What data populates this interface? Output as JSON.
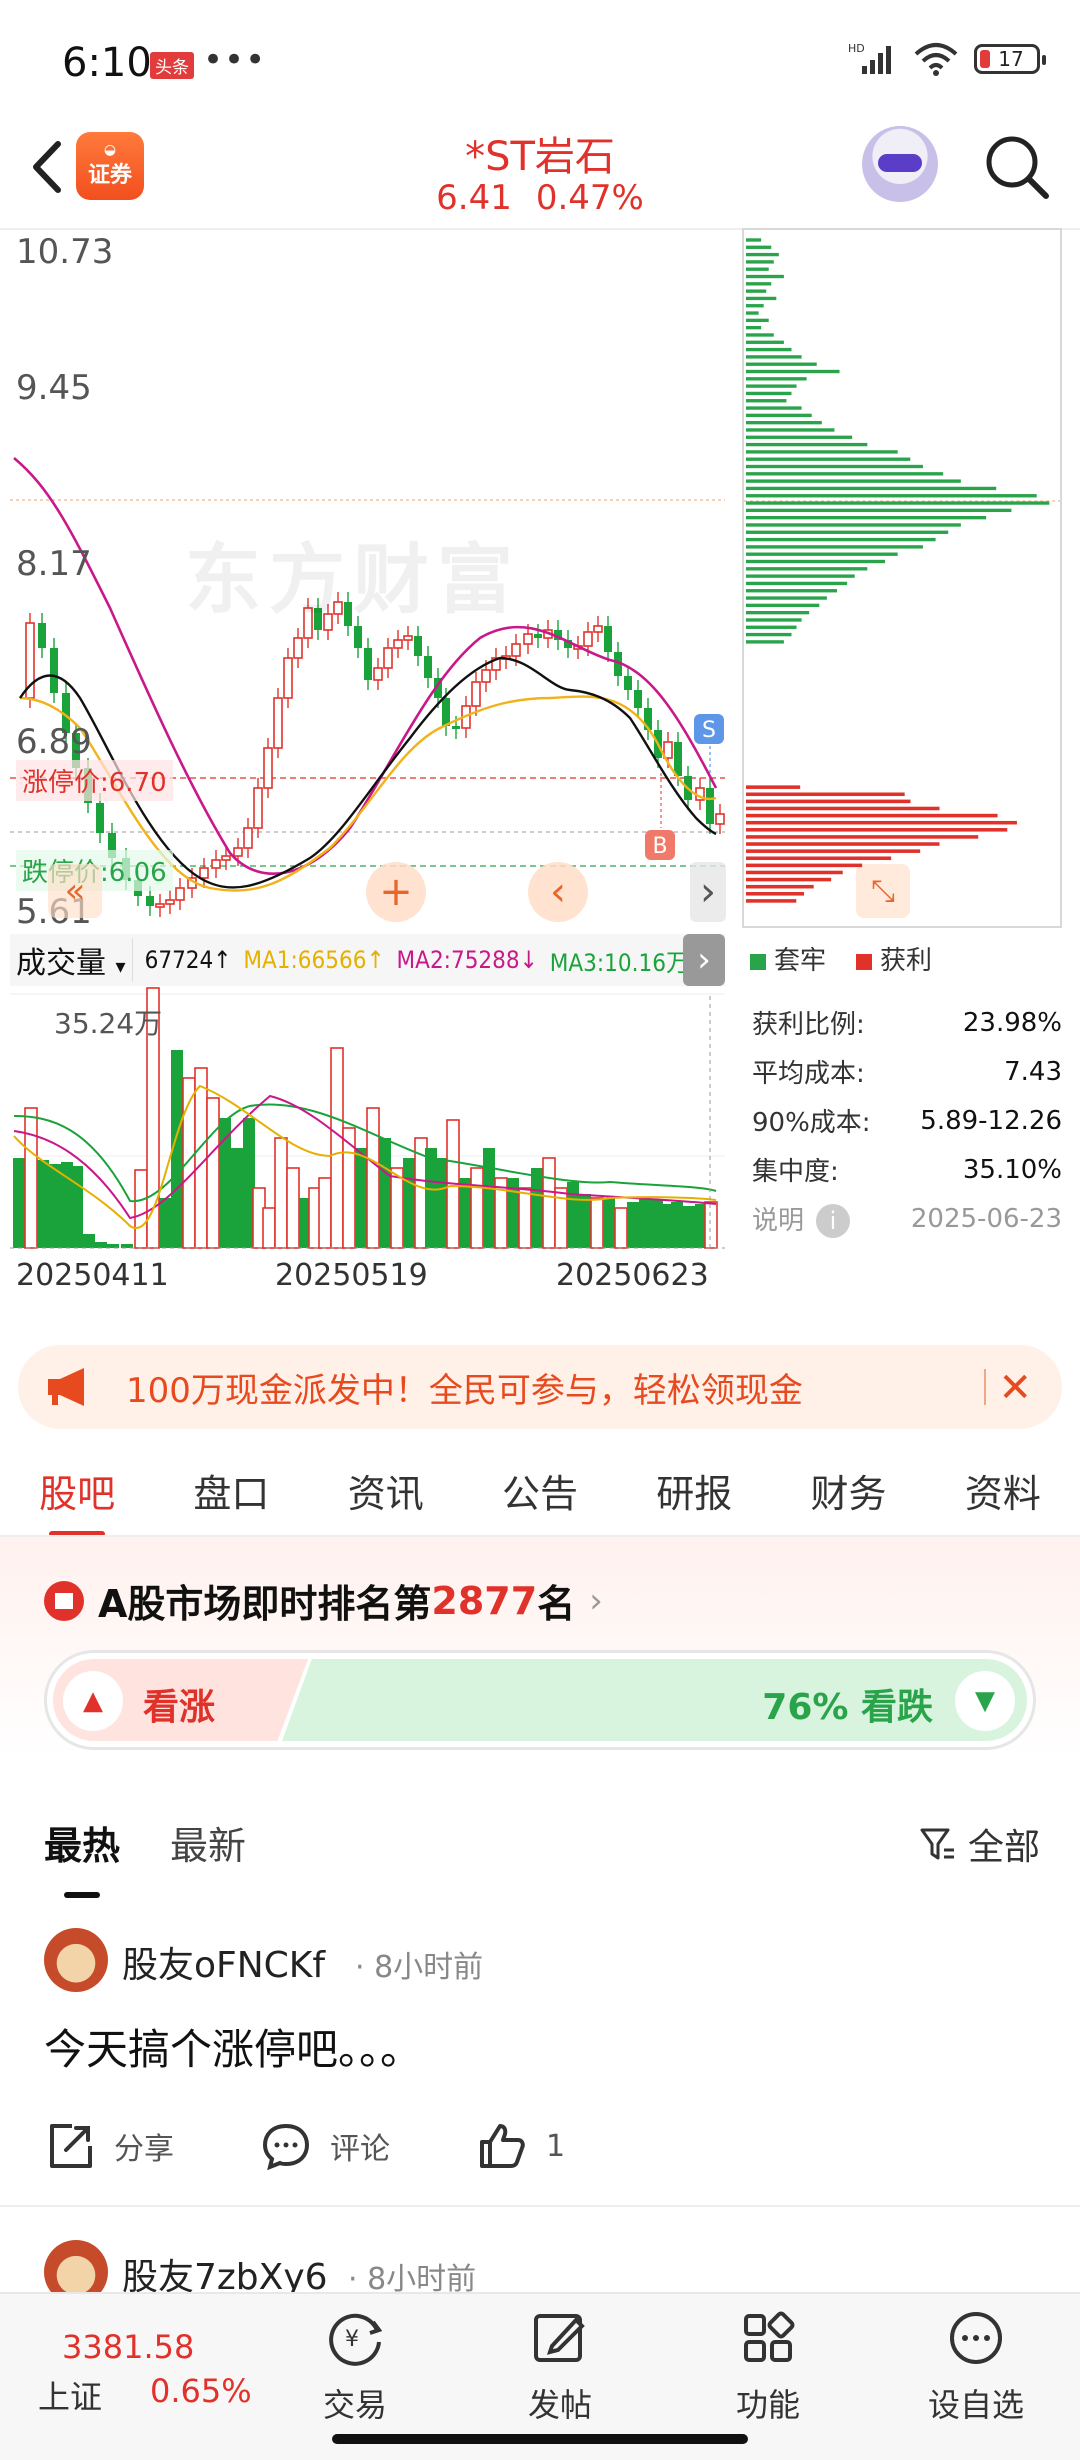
{
  "status_bar": {
    "time": "6:10",
    "app_badge": "头条",
    "dots": "•••",
    "network": "HD",
    "battery": "17"
  },
  "header": {
    "logo_text": "证券",
    "stock_name": "*ST岩石",
    "price": "6.41",
    "change_pct": "0.47%"
  },
  "kline": {
    "price_labels": [
      "10.73",
      "9.45",
      "8.17",
      "6.89",
      "5.61"
    ],
    "limit_up": "涨停价:6.70",
    "limit_down": "跌停价:6.06",
    "watermark": "东方财富",
    "buy_marker": "B",
    "sell_marker": "S",
    "colors": {
      "up": "#e0322b",
      "down": "#1aa33a",
      "ma5": "#111111",
      "ma10": "#f2b21a",
      "ma20": "#c8188a"
    }
  },
  "indicator_bar": {
    "selected": "成交量",
    "values": [
      {
        "text": "67724↑",
        "color": "#111111"
      },
      {
        "text": "MA1:66566↑",
        "color": "#e5b000"
      },
      {
        "text": "MA2:75288↓",
        "color": "#c8188a"
      },
      {
        "text": "MA3:10.16万↓",
        "color": "#1aa33a"
      }
    ]
  },
  "volume": {
    "max_label": "35.24万",
    "dates": [
      "20250411",
      "20250519",
      "20250623"
    ]
  },
  "chip_profile": {
    "legend_loss": "套牢",
    "legend_profit": "获利",
    "loss_color": "#2aa44a",
    "profit_color": "#e0322b",
    "stats": [
      {
        "label": "获利比例:",
        "value": "23.98%"
      },
      {
        "label": "平均成本:",
        "value": "7.43"
      },
      {
        "label": "90%成本:",
        "value": "5.89-12.26"
      },
      {
        "label": "集中度:",
        "value": "35.10%"
      }
    ],
    "note_label": "说明",
    "date": "2025-06-23"
  },
  "promo": {
    "text": "100万现金派发中！全民可参与，轻松领现金"
  },
  "tabs": [
    "股吧",
    "盘口",
    "资讯",
    "公告",
    "研报",
    "财务",
    "资料"
  ],
  "ranking": {
    "prefix": "A股市场即时排名第",
    "rank": "2877",
    "suffix": "名"
  },
  "sentiment": {
    "bull_label": "看涨",
    "bear_label": "76% 看跌",
    "bear_fraction": 0.76
  },
  "feed": {
    "tabs": [
      "最热",
      "最新"
    ],
    "filter": "全部"
  },
  "posts": [
    {
      "user": "股友oFNCKf",
      "time": "8小时前",
      "content": "今天搞个涨停吧。。。",
      "share": "分享",
      "comment": "评论",
      "likes": "1"
    },
    {
      "user": "股友7zbXy6",
      "time": "8小时前"
    }
  ],
  "bottom_nav": {
    "index_value": "3381.58",
    "index_name": "上证",
    "index_pct": "0.65%",
    "items": [
      "交易",
      "发帖",
      "功能",
      "设自选"
    ]
  }
}
